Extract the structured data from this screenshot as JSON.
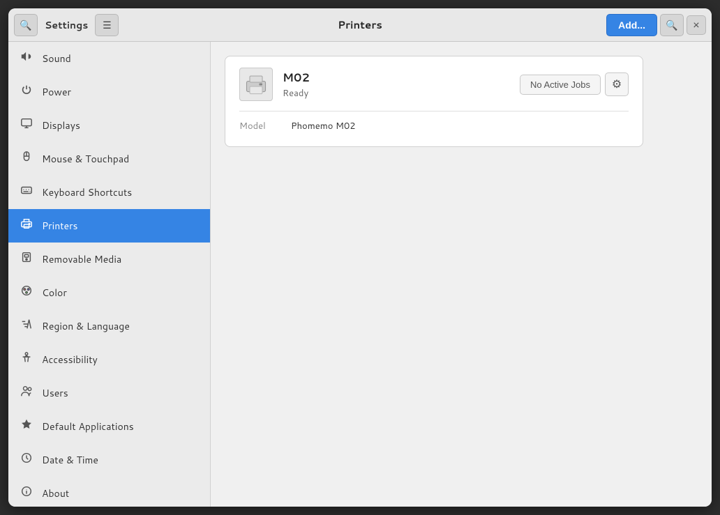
{
  "window": {
    "title": "Printers"
  },
  "header": {
    "settings_label": "Settings",
    "page_title": "Printers",
    "add_button_label": "Add...",
    "close_button_label": "×"
  },
  "sidebar": {
    "items": [
      {
        "id": "sound",
        "label": "Sound",
        "icon": "🔊"
      },
      {
        "id": "power",
        "label": "Power",
        "icon": "⏻"
      },
      {
        "id": "displays",
        "label": "Displays",
        "icon": "🖥"
      },
      {
        "id": "mouse-touchpad",
        "label": "Mouse & Touchpad",
        "icon": "🖱"
      },
      {
        "id": "keyboard-shortcuts",
        "label": "Keyboard Shortcuts",
        "icon": "⌨"
      },
      {
        "id": "printers",
        "label": "Printers",
        "icon": "🖨",
        "active": true
      },
      {
        "id": "removable-media",
        "label": "Removable Media",
        "icon": "💾"
      },
      {
        "id": "color",
        "label": "Color",
        "icon": "🎨"
      },
      {
        "id": "region-language",
        "label": "Region & Language",
        "icon": "🚩"
      },
      {
        "id": "accessibility",
        "label": "Accessibility",
        "icon": "♿"
      },
      {
        "id": "users",
        "label": "Users",
        "icon": "👥"
      },
      {
        "id": "default-applications",
        "label": "Default Applications",
        "icon": "⭐"
      },
      {
        "id": "date-time",
        "label": "Date & Time",
        "icon": "🕐"
      },
      {
        "id": "about",
        "label": "About",
        "icon": "✦"
      }
    ]
  },
  "printer": {
    "name": "M02",
    "status": "Ready",
    "model_label": "Model",
    "model_value": "Phomemo M02",
    "no_active_jobs_label": "No Active Jobs",
    "gear_icon": "⚙"
  }
}
